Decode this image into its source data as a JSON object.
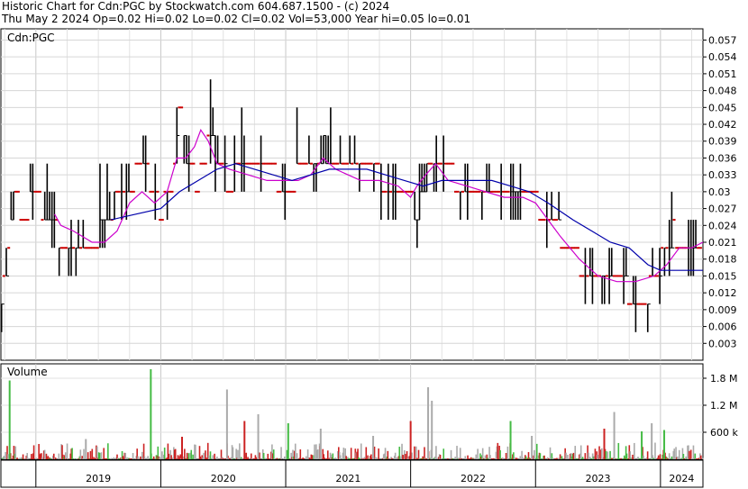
{
  "header": {
    "line1": "Historic Chart for Cdn:PGC by Stockwatch.com 604.687.1500 - (c) 2024",
    "line2": "Thu May  2 2024  Op=0.02  Hi=0.02  Lo=0.02  Cl=0.02  Vol=53,000  Year hi=0.05  lo=0.01"
  },
  "chart_data": {
    "type": "ohlc",
    "symbol_label": "Cdn:PGC",
    "volume_label": "Volume",
    "x_years": [
      "2019",
      "2020",
      "2021",
      "2022",
      "2023",
      "2024"
    ],
    "price_axis": {
      "ticks": [
        0.003,
        0.006,
        0.009,
        0.012,
        0.015,
        0.018,
        0.021,
        0.024,
        0.027,
        0.03,
        0.033,
        0.036,
        0.039,
        0.042,
        0.045,
        0.048,
        0.051,
        0.054,
        0.057
      ],
      "tick_labels": [
        "0.003",
        "0.006",
        "0.009",
        "0.012",
        "0.015",
        "0.018",
        "0.021",
        "0.024",
        "0.027",
        "0.03",
        "0.033",
        "0.036",
        "0.039",
        "0.042",
        "0.045",
        "0.048",
        "0.051",
        "0.054",
        "0.057"
      ],
      "range": [
        0,
        0.059
      ]
    },
    "volume_axis": {
      "ticks": [
        600000,
        1200000,
        1800000
      ],
      "tick_labels": [
        "600 k",
        "1.2 M",
        "1.8 M"
      ],
      "range": [
        0,
        2000000
      ]
    },
    "time_range": [
      2018.72,
      2024.34
    ],
    "price_path": [
      [
        2018.72,
        0.011
      ],
      [
        2018.78,
        0.018
      ],
      [
        2018.82,
        0.03
      ],
      [
        2018.9,
        0.026
      ],
      [
        2019.0,
        0.029
      ],
      [
        2019.1,
        0.025
      ],
      [
        2019.2,
        0.022
      ],
      [
        2019.35,
        0.02
      ],
      [
        2019.5,
        0.022
      ],
      [
        2019.6,
        0.027
      ],
      [
        2019.75,
        0.03
      ],
      [
        2019.85,
        0.036
      ],
      [
        2019.92,
        0.032
      ],
      [
        2020.0,
        0.026
      ],
      [
        2020.1,
        0.033
      ],
      [
        2020.15,
        0.046
      ],
      [
        2020.22,
        0.035
      ],
      [
        2020.3,
        0.031
      ],
      [
        2020.4,
        0.04
      ],
      [
        2020.48,
        0.033
      ],
      [
        2020.55,
        0.032
      ],
      [
        2020.65,
        0.034
      ],
      [
        2020.8,
        0.034
      ],
      [
        2020.9,
        0.033
      ],
      [
        2021.0,
        0.031
      ],
      [
        2021.1,
        0.033
      ],
      [
        2021.2,
        0.035
      ],
      [
        2021.3,
        0.038
      ],
      [
        2021.4,
        0.033
      ],
      [
        2021.5,
        0.034
      ],
      [
        2021.6,
        0.033
      ],
      [
        2021.7,
        0.035
      ],
      [
        2021.8,
        0.031
      ],
      [
        2021.9,
        0.03
      ],
      [
        2022.0,
        0.03
      ],
      [
        2022.05,
        0.026
      ],
      [
        2022.15,
        0.036
      ],
      [
        2022.2,
        0.034
      ],
      [
        2022.3,
        0.033
      ],
      [
        2022.4,
        0.032
      ],
      [
        2022.55,
        0.032
      ],
      [
        2022.7,
        0.031
      ],
      [
        2022.85,
        0.029
      ],
      [
        2023.0,
        0.028
      ],
      [
        2023.1,
        0.026
      ],
      [
        2023.25,
        0.02
      ],
      [
        2023.4,
        0.016
      ],
      [
        2023.55,
        0.014
      ],
      [
        2023.7,
        0.013
      ],
      [
        2023.8,
        0.011
      ],
      [
        2023.9,
        0.012
      ],
      [
        2024.0,
        0.017
      ],
      [
        2024.1,
        0.023
      ],
      [
        2024.2,
        0.021
      ],
      [
        2024.34,
        0.02
      ]
    ],
    "moving_averages": [
      {
        "color": "#cc00cc",
        "points": [
          [
            2019.15,
            0.026
          ],
          [
            2019.2,
            0.024
          ],
          [
            2019.3,
            0.023
          ],
          [
            2019.45,
            0.021
          ],
          [
            2019.55,
            0.021
          ],
          [
            2019.65,
            0.023
          ],
          [
            2019.75,
            0.028
          ],
          [
            2019.85,
            0.03
          ],
          [
            2019.95,
            0.028
          ],
          [
            2020.05,
            0.03
          ],
          [
            2020.13,
            0.036
          ],
          [
            2020.2,
            0.036
          ],
          [
            2020.27,
            0.038
          ],
          [
            2020.32,
            0.041
          ],
          [
            2020.38,
            0.039
          ],
          [
            2020.45,
            0.035
          ],
          [
            2020.55,
            0.034
          ],
          [
            2020.7,
            0.033
          ],
          [
            2020.85,
            0.032
          ],
          [
            2021.0,
            0.032
          ],
          [
            2021.1,
            0.032
          ],
          [
            2021.2,
            0.033
          ],
          [
            2021.3,
            0.036
          ],
          [
            2021.4,
            0.034
          ],
          [
            2021.5,
            0.033
          ],
          [
            2021.6,
            0.032
          ],
          [
            2021.75,
            0.032
          ],
          [
            2021.9,
            0.031
          ],
          [
            2022.0,
            0.029
          ],
          [
            2022.05,
            0.031
          ],
          [
            2022.12,
            0.033
          ],
          [
            2022.2,
            0.035
          ],
          [
            2022.3,
            0.032
          ],
          [
            2022.45,
            0.031
          ],
          [
            2022.6,
            0.03
          ],
          [
            2022.75,
            0.029
          ],
          [
            2022.9,
            0.029
          ],
          [
            2023.0,
            0.028
          ],
          [
            2023.1,
            0.025
          ],
          [
            2023.2,
            0.022
          ],
          [
            2023.35,
            0.018
          ],
          [
            2023.5,
            0.015
          ],
          [
            2023.65,
            0.014
          ],
          [
            2023.8,
            0.014
          ],
          [
            2023.95,
            0.015
          ],
          [
            2024.05,
            0.017
          ],
          [
            2024.15,
            0.02
          ],
          [
            2024.25,
            0.02
          ],
          [
            2024.34,
            0.021
          ]
        ]
      },
      {
        "color": "#0000aa",
        "points": [
          [
            2019.6,
            0.025
          ],
          [
            2019.8,
            0.026
          ],
          [
            2020.0,
            0.027
          ],
          [
            2020.15,
            0.03
          ],
          [
            2020.3,
            0.032
          ],
          [
            2020.45,
            0.034
          ],
          [
            2020.6,
            0.035
          ],
          [
            2020.75,
            0.034
          ],
          [
            2020.9,
            0.033
          ],
          [
            2021.05,
            0.032
          ],
          [
            2021.2,
            0.033
          ],
          [
            2021.35,
            0.034
          ],
          [
            2021.5,
            0.034
          ],
          [
            2021.65,
            0.034
          ],
          [
            2021.8,
            0.033
          ],
          [
            2021.95,
            0.032
          ],
          [
            2022.1,
            0.031
          ],
          [
            2022.25,
            0.032
          ],
          [
            2022.45,
            0.032
          ],
          [
            2022.65,
            0.032
          ],
          [
            2022.8,
            0.031
          ],
          [
            2022.95,
            0.03
          ],
          [
            2023.1,
            0.028
          ],
          [
            2023.3,
            0.025
          ],
          [
            2023.45,
            0.023
          ],
          [
            2023.6,
            0.021
          ],
          [
            2023.75,
            0.02
          ],
          [
            2023.9,
            0.017
          ],
          [
            2024.0,
            0.016
          ],
          [
            2024.1,
            0.016
          ],
          [
            2024.2,
            0.016
          ],
          [
            2024.34,
            0.016
          ]
        ]
      }
    ],
    "volume_spikes": [
      [
        2018.79,
        1750000,
        "#44bb44"
      ],
      [
        2019.92,
        2000000,
        "#44bb44"
      ],
      [
        2020.53,
        1550000,
        "#aaaaaa"
      ],
      [
        2020.78,
        1000000,
        "#aaaaaa"
      ],
      [
        2020.67,
        850000,
        "#cc2222"
      ],
      [
        2021.02,
        800000,
        "#44bb44"
      ],
      [
        2021.28,
        680000,
        "#aaaaaa"
      ],
      [
        2022.0,
        850000,
        "#cc2222"
      ],
      [
        2022.14,
        1600000,
        "#aaaaaa"
      ],
      [
        2022.17,
        1300000,
        "#aaaaaa"
      ],
      [
        2022.8,
        850000,
        "#44bb44"
      ],
      [
        2022.97,
        520000,
        "#aaaaaa"
      ],
      [
        2023.55,
        680000,
        "#cc2222"
      ],
      [
        2023.63,
        1050000,
        "#aaaaaa"
      ],
      [
        2023.93,
        800000,
        "#aaaaaa"
      ],
      [
        2024.03,
        650000,
        "#44bb44"
      ],
      [
        2023.85,
        620000,
        "#44bb44"
      ],
      [
        2020.17,
        500000,
        "#cc2222"
      ],
      [
        2021.7,
        520000,
        "#aaaaaa"
      ],
      [
        2019.4,
        450000,
        "#aaaaaa"
      ]
    ]
  }
}
